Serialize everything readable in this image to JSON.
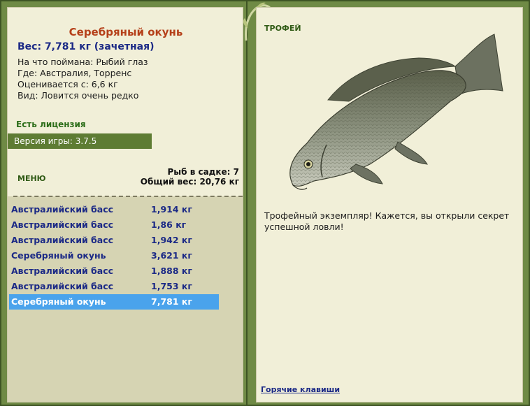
{
  "fish": {
    "title": "Серебряный окунь",
    "weight": "Вес: 7,781 кг (зачетная)",
    "details": [
      "На что поймана: Рыбий глаз",
      "Где: Австралия, Торренс",
      "Оценивается с: 6,6 кг",
      "Вид: Ловится очень редко"
    ]
  },
  "license": "Есть лицензия",
  "version": "Версия игры: 3.7.5",
  "menu_label": "МЕНЮ",
  "keep_stats": {
    "count": "Рыб в садке: 7",
    "total": "Общий вес: 20,76 кг"
  },
  "catches": [
    {
      "name": "Австралийский басс",
      "weight": "1,914 кг"
    },
    {
      "name": "Австралийский басс",
      "weight": "1,86 кг"
    },
    {
      "name": "Австралийский басс",
      "weight": "1,942 кг"
    },
    {
      "name": "Серебряный окунь",
      "weight": "3,621 кг"
    },
    {
      "name": "Австралийский басс",
      "weight": "1,888 кг"
    },
    {
      "name": "Австралийский басс",
      "weight": "1,753 кг"
    },
    {
      "name": "Серебряный окунь",
      "weight": "7,781 кг"
    }
  ],
  "selected_catch_index": 6,
  "trophy": {
    "label": "ТРОФЕЙ",
    "text": "Трофейный экземпляр! Кажется, вы открыли секрет успешной ловли!"
  },
  "hotkeys": "Горячие клавиши",
  "colors": {
    "frame": "#6f8a45",
    "panel": "#f1efd8",
    "selected": "#4aa3ec",
    "title": "#b5401a",
    "link": "#1c2a86"
  },
  "icons": {
    "fish_picture": "silver-perch-fish-image",
    "vine": "vine-decoration"
  }
}
